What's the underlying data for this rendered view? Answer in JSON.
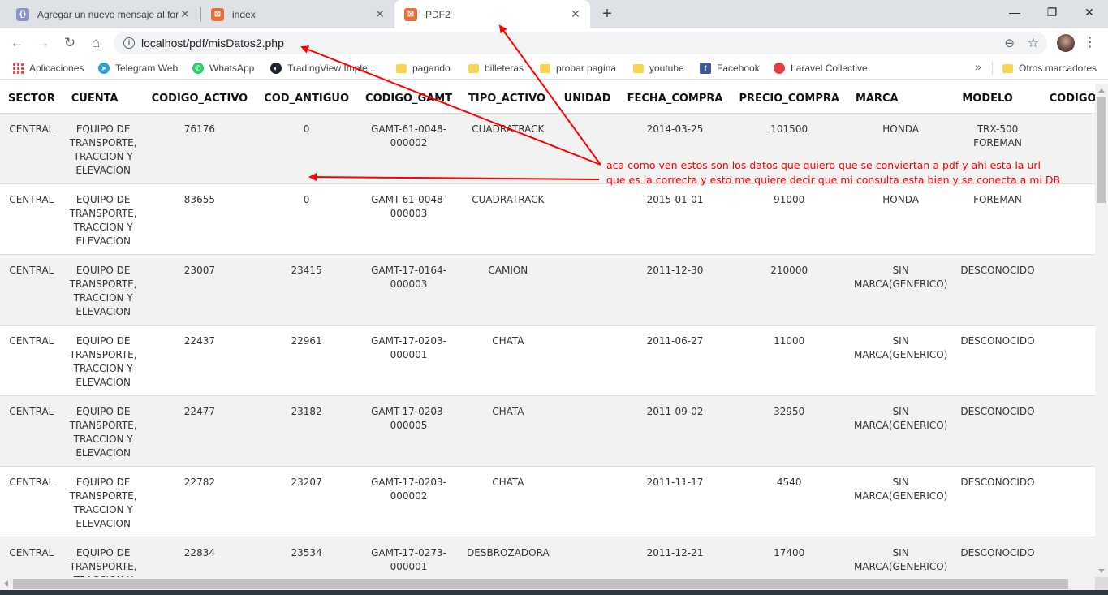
{
  "tabs": [
    {
      "title": "Agregar un nuevo mensaje al foro",
      "icon": "braces-icon"
    },
    {
      "title": "index",
      "icon": "xampp-icon"
    },
    {
      "title": "PDF2",
      "icon": "xampp-icon",
      "active": true
    }
  ],
  "address": {
    "url": "localhost/pdf/misDatos2.php"
  },
  "bookmarks": [
    {
      "label": "Aplicaciones",
      "icon": "apps-grid-icon"
    },
    {
      "label": "Telegram Web",
      "icon": "telegram-icon"
    },
    {
      "label": "WhatsApp",
      "icon": "whatsapp-icon"
    },
    {
      "label": "TradingView Imple...",
      "icon": "tradingview-icon"
    },
    {
      "label": "pagando",
      "icon": "folder-icon"
    },
    {
      "label": "billeteras",
      "icon": "folder-icon"
    },
    {
      "label": "probar pagina",
      "icon": "folder-icon"
    },
    {
      "label": "youtube",
      "icon": "folder-icon"
    },
    {
      "label": "Facebook",
      "icon": "facebook-icon"
    },
    {
      "label": "Laravel Collective",
      "icon": "laravel-icon"
    }
  ],
  "bookmarks_more": "»",
  "other_bookmarks": "Otros marcadores",
  "table": {
    "headers": [
      "SECTOR",
      "CUENTA",
      "CODIGO_ACTIVO",
      "COD_ANTIGUO",
      "CODIGO_GAMT",
      "TIPO_ACTIVO",
      "UNIDAD",
      "FECHA_COMPRA",
      "PRECIO_COMPRA",
      "MARCA",
      "MODELO",
      "CODIGO_CONTABLE"
    ],
    "rows": [
      [
        "CENTRAL",
        "EQUIPO DE TRANSPORTE, TRACCION Y ELEVACION",
        "76176",
        "0",
        "GAMT-61-0048-000002",
        "CUADRATRACK",
        "",
        "2014-03-25",
        "101500",
        "HONDA",
        "TRX-500 FOREMAN",
        ""
      ],
      [
        "CENTRAL",
        "EQUIPO DE TRANSPORTE, TRACCION Y ELEVACION",
        "83655",
        "0",
        "GAMT-61-0048-000003",
        "CUADRATRACK",
        "",
        "2015-01-01",
        "91000",
        "HONDA",
        "FOREMAN",
        ""
      ],
      [
        "CENTRAL",
        "EQUIPO DE TRANSPORTE, TRACCION Y ELEVACION",
        "23007",
        "23415",
        "GAMT-17-0164-000003",
        "CAMION",
        "",
        "2011-12-30",
        "210000",
        "SIN MARCA(GENERICO)",
        "DESCONOCIDO",
        ""
      ],
      [
        "CENTRAL",
        "EQUIPO DE TRANSPORTE, TRACCION Y ELEVACION",
        "22437",
        "22961",
        "GAMT-17-0203-000001",
        "CHATA",
        "",
        "2011-06-27",
        "11000",
        "SIN MARCA(GENERICO)",
        "DESCONOCIDO",
        ""
      ],
      [
        "CENTRAL",
        "EQUIPO DE TRANSPORTE, TRACCION Y ELEVACION",
        "22477",
        "23182",
        "GAMT-17-0203-000005",
        "CHATA",
        "",
        "2011-09-02",
        "32950",
        "SIN MARCA(GENERICO)",
        "DESCONOCIDO",
        ""
      ],
      [
        "CENTRAL",
        "EQUIPO DE TRANSPORTE, TRACCION Y ELEVACION",
        "22782",
        "23207",
        "GAMT-17-0203-000002",
        "CHATA",
        "",
        "2011-11-17",
        "4540",
        "SIN MARCA(GENERICO)",
        "DESCONOCIDO",
        ""
      ],
      [
        "CENTRAL",
        "EQUIPO DE TRANSPORTE, TRACCION Y ELEVACION",
        "22834",
        "23534",
        "GAMT-17-0273-000001",
        "DESBROZADORA",
        "",
        "2011-12-21",
        "17400",
        "SIN MARCA(GENERICO)",
        "DESCONOCIDO",
        ""
      ]
    ]
  },
  "annotation": {
    "line1": "aca como ven estos son los datos que quiero que se conviertan a pdf y ahi esta la url",
    "line2": "que es la correcta y esto me quiere decir que mi consulta esta bien y se conecta a mi DB",
    "color": "#ff0000"
  }
}
